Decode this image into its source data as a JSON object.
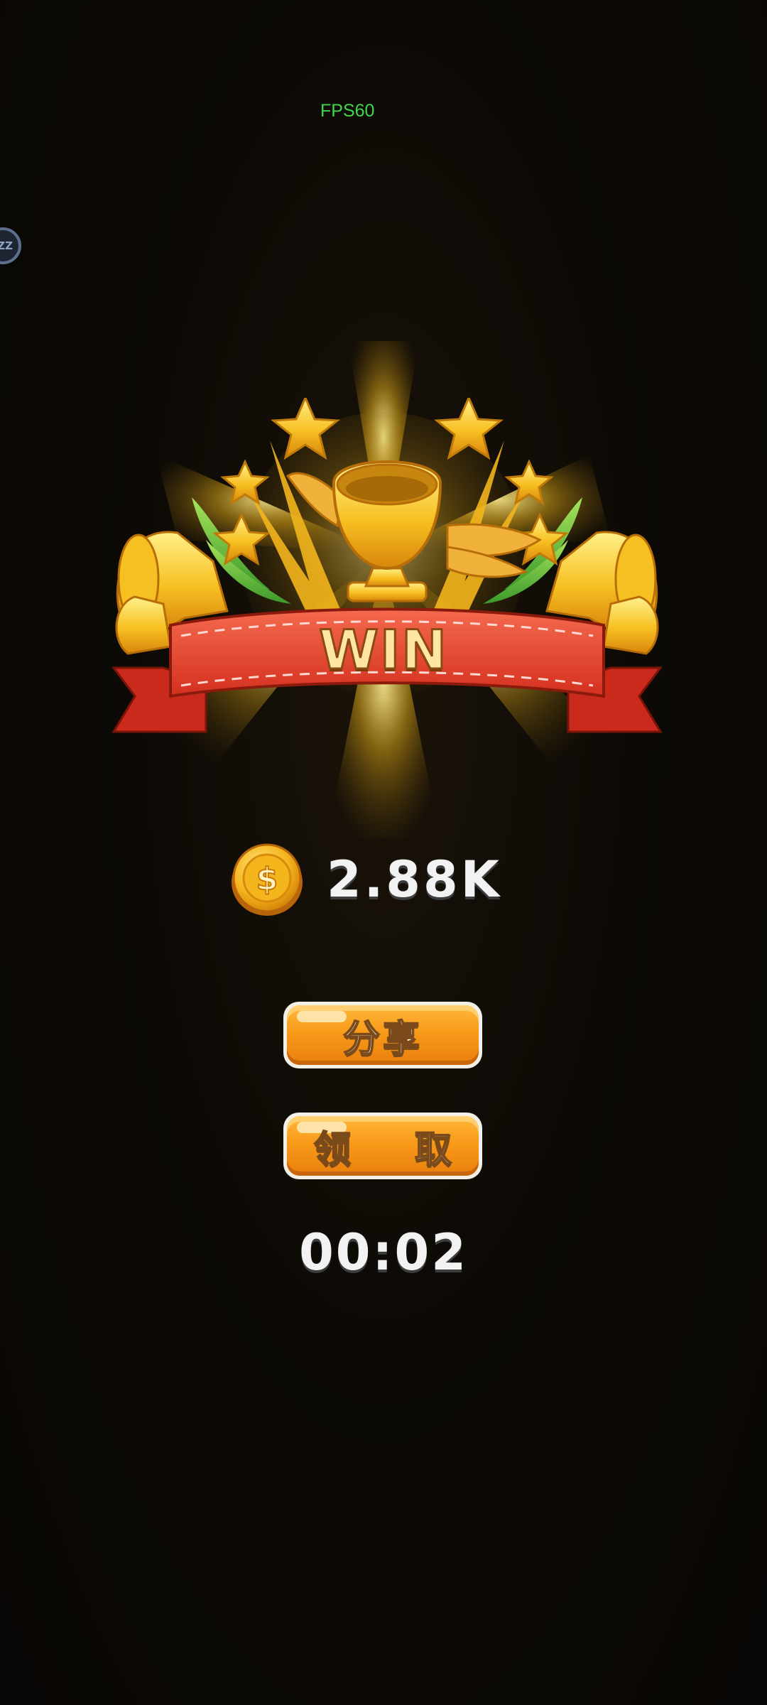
{
  "overlay": {
    "fps_label": "FPS60",
    "float_ball_label": "ZZ"
  },
  "result": {
    "banner_text": "WIN",
    "reward_icon": "dollar-coin-icon",
    "reward_amount": "2.88K"
  },
  "buttons": {
    "share_label": "分享",
    "claim_label": "领 取"
  },
  "timer": {
    "value": "00:02"
  },
  "colors": {
    "background": "#0b0805",
    "fps_text": "#3fd64a",
    "ribbon_red": "#e6432f",
    "gold": "#f5b51c",
    "button_orange": "#f89a1a"
  }
}
